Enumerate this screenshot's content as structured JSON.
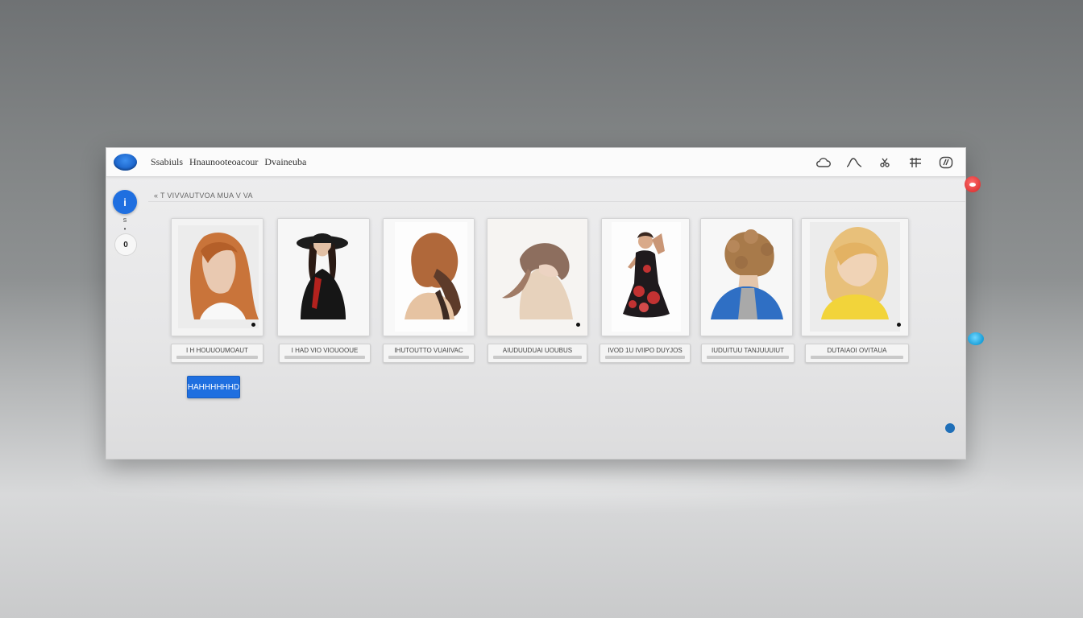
{
  "titlebar": {
    "menu": [
      "Ssabiuls",
      "Hnaunooteoacour",
      "Dvaineuba"
    ],
    "icons": [
      "cloud-icon",
      "wave-icon",
      "scissors-icon",
      "grid-icon",
      "settings-icon"
    ]
  },
  "rail": {
    "primary_label": "i",
    "caption": "s",
    "dot": "•",
    "secondary_label": "0"
  },
  "breadcrumb": "« T VIVVAUTVOA MUA V VA",
  "gallery": {
    "items": [
      {
        "caption": "I H HOUUOUMOAUT",
        "image": "red-haired-woman-portrait"
      },
      {
        "caption": "I HAD VIO VIOUOOUE",
        "image": "woman-in-black-hat"
      },
      {
        "caption": "IHUTOUTTO VUAIIVAC",
        "image": "auburn-hair-back-view"
      },
      {
        "caption": "AIUDUUDUAI UOUBUS",
        "image": "woman-bowing-long-hair"
      },
      {
        "caption": "IVOD 1U IVIIPO DUYJOS",
        "image": "dancer-floral-dress"
      },
      {
        "caption": "IUDUITUU TANJUUUIUT",
        "image": "curly-hair-blue-jacket"
      },
      {
        "caption": "DUTAIAOI OVITAUA",
        "image": "blonde-hair-yellow-top"
      }
    ]
  },
  "actions": {
    "primary_button": "HAHHHHHHD"
  },
  "colors": {
    "accent": "#1f6fe0",
    "status_dot": "#1f6fb8",
    "notification_red": "#e03a3a",
    "notification_cyan": "#1a9fd8"
  }
}
